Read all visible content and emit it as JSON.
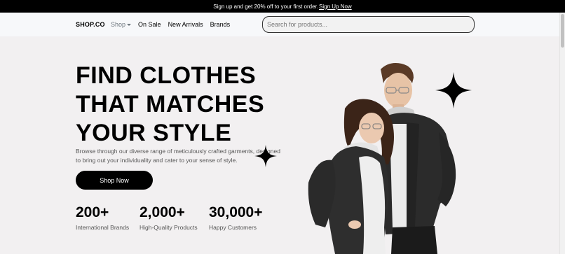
{
  "topbar": {
    "text": "Sign up and get 20% off to your first order.",
    "link": "Sign Up Now"
  },
  "nav": {
    "logo": "SHOP.CO",
    "links": [
      "Shop",
      "On Sale",
      "New Arrivals",
      "Brands"
    ],
    "search_placeholder": "Search for products..."
  },
  "hero": {
    "title_lines": [
      "FIND CLOTHES",
      "THAT MATCHES",
      "YOUR STYLE"
    ],
    "description": "Browse through our diverse range of meticulously crafted garments, designed to bring out your individuality and cater to your sense of style.",
    "cta": "Shop Now"
  },
  "stats": [
    {
      "value": "200+",
      "label": "International Brands"
    },
    {
      "value": "2,000+",
      "label": "High-Quality Products"
    },
    {
      "value": "30,000+",
      "label": "Happy Customers"
    }
  ],
  "colors": {
    "topbar": "#000000",
    "background": "#f2f0f1",
    "button": "#000000",
    "navbar": "#f7f8fa"
  },
  "icons": {
    "sparkle": "four-point-star-icon",
    "caret": "chevron-down-icon"
  }
}
